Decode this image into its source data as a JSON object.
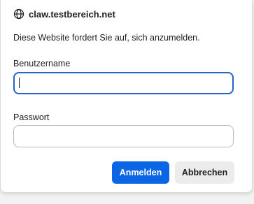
{
  "header": {
    "site": "claw.testbereich.net",
    "icon": "globe-icon"
  },
  "message": "Diese Website fordert Sie auf, sich anzumelden.",
  "form": {
    "username_label": "Benutzername",
    "username_value": "",
    "password_label": "Passwort",
    "password_value": ""
  },
  "buttons": {
    "submit": "Anmelden",
    "cancel": "Abbrechen"
  },
  "colors": {
    "primary": "#0a66e4",
    "focus_border": "#2864c8",
    "secondary_bg": "#ececec"
  }
}
